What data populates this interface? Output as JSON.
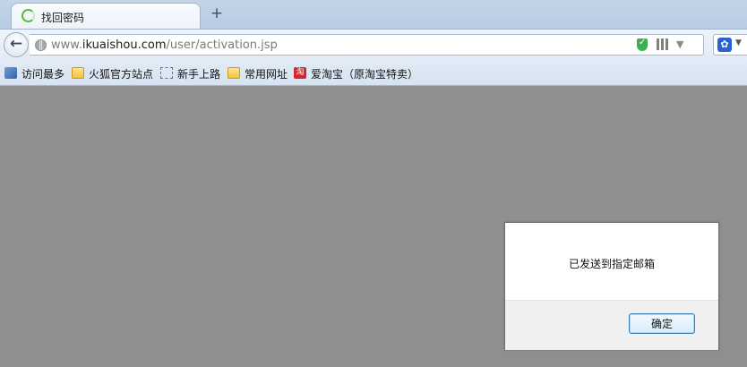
{
  "tab": {
    "title": "找回密码",
    "new_tab_symbol": "+"
  },
  "nav": {
    "back_symbol": "←",
    "url_prefix": "www.",
    "url_domain": "ikuaishou.com",
    "url_path": "/user/activation.jsp",
    "star_symbol": "▽",
    "dropdown_symbol": "▼",
    "search_engine_icon": "paw-icon"
  },
  "bookmarks": [
    {
      "label": "访问最多",
      "icon": "most-visited-icon"
    },
    {
      "label": "火狐官方站点",
      "icon": "folder-icon"
    },
    {
      "label": "新手上路",
      "icon": "dashed-page-icon"
    },
    {
      "label": "常用网址",
      "icon": "folder-icon"
    },
    {
      "label": "爱淘宝（原淘宝特卖）",
      "icon": "taobao-icon",
      "icon_text": "淘"
    }
  ],
  "dialog": {
    "message": "已发送到指定邮箱",
    "ok_label": "确定"
  },
  "colors": {
    "page_overlay": "#8f8f8f",
    "tabstrip": "#c5d5e8",
    "dialog_button_border": "#3c7fb1",
    "shield_green": "#3fae52"
  }
}
